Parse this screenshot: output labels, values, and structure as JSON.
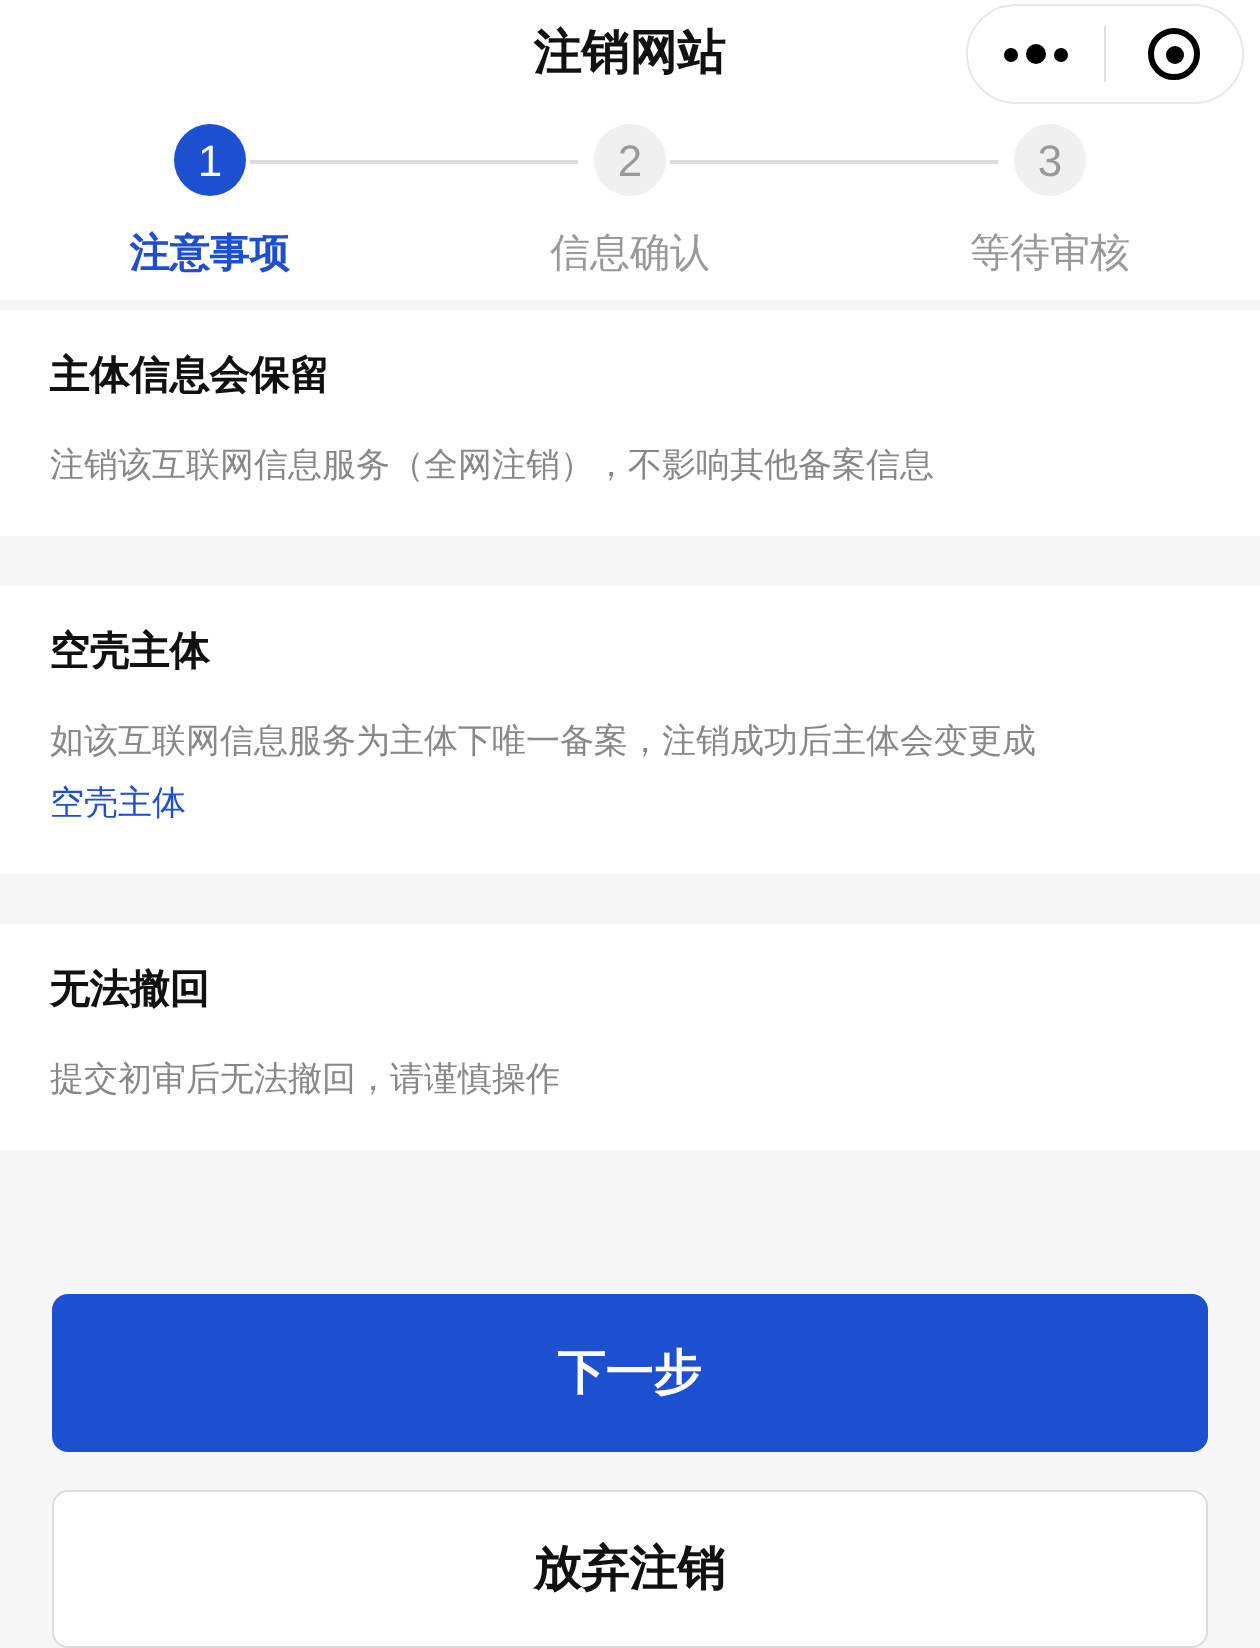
{
  "window": {
    "title": "注销网站"
  },
  "steps": [
    {
      "number": "1",
      "label": "注意事项",
      "selected": true
    },
    {
      "number": "2",
      "label": "信息确认",
      "selected": false
    },
    {
      "number": "3",
      "label": "等待审核",
      "selected": false
    }
  ],
  "notices": [
    {
      "title": "主体信息会保留",
      "text": "注销该互联网信息服务（全网注销），不影响其他备案信息"
    },
    {
      "title": "空壳主体",
      "text": "如该互联网信息服务为主体下唯一备案，注销成功后主体会变更成",
      "link": "空壳主体"
    },
    {
      "title": "无法撤回",
      "text": "提交初审后无法撤回，请谨慎操作"
    }
  ],
  "buttons": [
    {
      "label": "下一步",
      "kind": "primary"
    },
    {
      "label": "放弃注销",
      "kind": "secondary"
    }
  ]
}
